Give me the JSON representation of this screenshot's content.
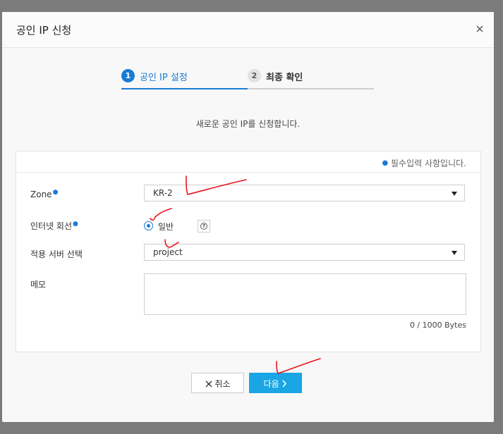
{
  "dialog": {
    "title": "공인 IP 신청",
    "close_icon": "close-icon"
  },
  "steps": [
    {
      "number": "1",
      "label": "공인 IP 설정",
      "active": true
    },
    {
      "number": "2",
      "label": "최종 확인",
      "active": false
    }
  ],
  "intro_text": "새로운 공인 IP를 신청합니다.",
  "required_note": "필수입력 사항입니다.",
  "form": {
    "zone": {
      "label": "Zone",
      "value": "KR-2"
    },
    "line": {
      "label": "인터넷 회선",
      "option_label": "일반",
      "help_icon": "help-circle-icon"
    },
    "server": {
      "label": "적용 서버 선택",
      "value": "project"
    },
    "memo": {
      "label": "메모",
      "value": "",
      "counter": "0 / 1000 Bytes"
    }
  },
  "buttons": {
    "cancel_label": "취소",
    "next_label": "다음"
  },
  "colors": {
    "accent": "#1a7bd5",
    "primary_button": "#1aa6e4",
    "annotation": "#e8141b"
  }
}
